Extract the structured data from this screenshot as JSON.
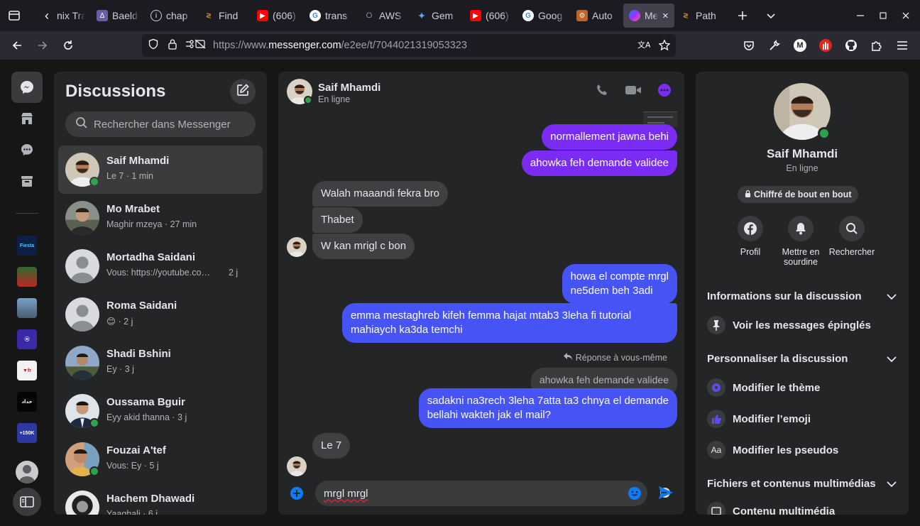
{
  "browser": {
    "tabs": [
      {
        "title": "nix Tra",
        "fav": "#3c3c3c",
        "icon": "back-chevron"
      },
      {
        "title": "Baeld",
        "fav": "#6b5ca5",
        "icon": "baeldung"
      },
      {
        "title": "chap",
        "fav": "#1c1b22",
        "icon": "info"
      },
      {
        "title": "Find",
        "fav": "#1c1b22",
        "icon": "findrobot"
      },
      {
        "title": "(606)",
        "fav": "#ff0000",
        "icon": "youtube"
      },
      {
        "title": "trans",
        "fav": "#ffffff",
        "icon": "google"
      },
      {
        "title": "AWS",
        "fav": "#1c1b22",
        "icon": "openai"
      },
      {
        "title": "Gem",
        "fav": "#1c1b22",
        "icon": "gemini"
      },
      {
        "title": "(606)",
        "fav": "#ff0000",
        "icon": "youtube"
      },
      {
        "title": "Goog",
        "fav": "#ffffff",
        "icon": "google"
      },
      {
        "title": "Auto",
        "fav": "#c0652a",
        "icon": "auto"
      },
      {
        "title": "Me",
        "fav": "#1c1b22",
        "icon": "messenger",
        "active": true
      },
      {
        "title": "Path",
        "fav": "#1c1b22",
        "icon": "path"
      }
    ],
    "url_prefix": "https://www.",
    "url_host": "messenger.com",
    "url_path": "/e2ee/t/7044021319053323"
  },
  "sidebar": {
    "title": "Discussions",
    "search_placeholder": "Rechercher dans Messenger",
    "conversations": [
      {
        "name": "Saif Mhamdi",
        "preview": "Le 7 · 1 min",
        "online": true,
        "selected": true,
        "avatar": "photo1"
      },
      {
        "name": "Mo Mrabet",
        "preview": "Maghir mzeya · 27 min",
        "online": false,
        "avatar": "photo2"
      },
      {
        "name": "Mortadha Saidani",
        "preview": "Vous: https://youtube.co…",
        "time": "2 j",
        "online": false,
        "avatar": "default"
      },
      {
        "name": "Roma Saidani",
        "preview": "😊 · 2 j",
        "online": false,
        "avatar": "default"
      },
      {
        "name": "Shadi Bshini",
        "preview": "Ey · 3 j",
        "online": false,
        "avatar": "photo3"
      },
      {
        "name": "Oussama Bguir",
        "preview": "Eyy akid thanna · 3 j",
        "online": true,
        "avatar": "photo4"
      },
      {
        "name": "Fouzai A'tef",
        "preview": "Vous: Ey · 5 j",
        "online": true,
        "avatar": "photo5"
      },
      {
        "name": "Hachem Dhawadi",
        "preview": "Yaaghali · 6 j",
        "online": false,
        "avatar": "photo6"
      }
    ]
  },
  "chat": {
    "contact_name": "Saif Mhamdi",
    "status": "En ligne",
    "messages": {
      "m1": "normallement jawna behi",
      "m2": "ahowka feh demande validee",
      "m3": "Walah maaandi fekra bro",
      "m4": "Thabet",
      "m5": "W kan mrigl c bon",
      "m6a": "howa el compte mrgl",
      "m6b": "ne5dem beh 3adi",
      "m7a": "emma mestaghreb kifeh femma hajat mtab3 3leha fi tutorial",
      "m7b": "mahiaych ka3da temchi",
      "reply_label": "Réponse à vous-même",
      "reply_quote": "ahowka feh demande validee",
      "m8a": "sadakni na3rech 3leha 7atta ta3 chnya el demande",
      "m8b": "bellahi wakteh jak el mail?",
      "m9": "Le 7"
    },
    "composer_value": "mrgl mrgl"
  },
  "info": {
    "name": "Saif Mhamdi",
    "status": "En ligne",
    "encryption": "Chiffré de bout en bout",
    "actions": [
      {
        "label": "Profil",
        "icon": "facebook-icon"
      },
      {
        "label": "Mettre en sourdine",
        "icon": "bell-icon"
      },
      {
        "label": "Rechercher",
        "icon": "search-icon"
      }
    ],
    "section1": "Informations sur la discussion",
    "pinned": "Voir les messages épinglés",
    "section2": "Personnaliser la discussion",
    "theme": "Modifier le thème",
    "emoji": "Modifier l’emoji",
    "nicknames": "Modifier les pseudos",
    "section3": "Fichiers et contenus multimédias",
    "media": "Contenu multimédia"
  },
  "colors": {
    "accent": "#7a2cf5",
    "blue_bubble": "#4654f5",
    "online": "#31a24c",
    "link": "#0a7cff"
  }
}
